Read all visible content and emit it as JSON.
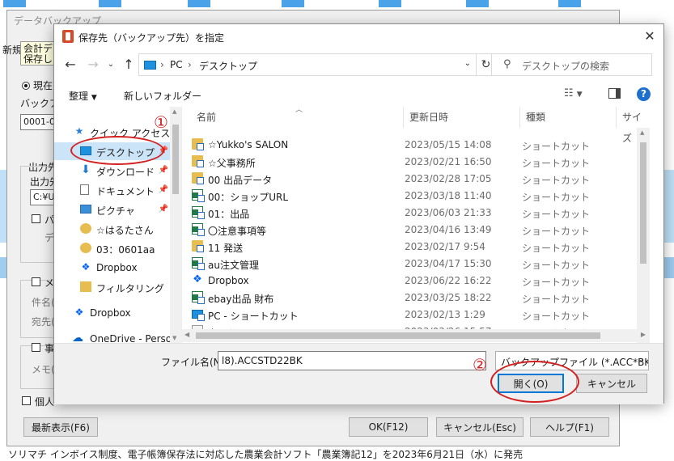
{
  "background": {
    "news_line": "ソリマチ インボイス制度、電子帳簿保存法に対応した農業会計ソフト「農業簿記12」を2023年6月21日（水）に発売"
  },
  "parent_dialog": {
    "title": "データバックアップ",
    "frag_new": "新規",
    "frag_kaikei": "会計デ",
    "frag_hozon": "保存し",
    "radio_current": "現在",
    "label_backup": "バックア",
    "input_code": "0001-0",
    "label_output": "出力先",
    "label_output2": "出力先",
    "input_path": "C:¥U",
    "chk_pa": "パ",
    "frag_de": "デ",
    "chk_me": "メ",
    "frag_kenmei": "件名(",
    "frag_atesaki": "宛先(",
    "chk_ji": "事",
    "frag_memo": "メモ(",
    "chk_kojin": "個人",
    "refresh_button": "最新表示(F6)",
    "ok_button": "OK(F12)",
    "cancel_button": "キャンセル(Esc)",
    "help_button": "ヘルプ(F1)"
  },
  "dialog": {
    "title": "保存先（バックアップ先）を指定",
    "breadcrumb": [
      "PC",
      "デスクトップ"
    ],
    "search_placeholder": "デスクトップの検索",
    "toolbar": {
      "organize": "整理",
      "new_folder": "新しいフォルダー"
    },
    "nav_items": [
      {
        "label": "クイック アクセス",
        "icon": "star-icon"
      },
      {
        "label": "デスクトップ",
        "icon": "desktop-icon",
        "selected": true
      },
      {
        "label": "ダウンロード",
        "icon": "download-icon"
      },
      {
        "label": "ドキュメント",
        "icon": "document-icon"
      },
      {
        "label": "ピクチャ",
        "icon": "pictures-icon"
      },
      {
        "label": "☆はるたさん",
        "icon": "shortcut-folder-icon"
      },
      {
        "label": "03：0601aa",
        "icon": "shortcut-folder-icon"
      },
      {
        "label": "Dropbox",
        "icon": "dropbox-icon"
      },
      {
        "label": "フィルタリング",
        "icon": "folder-icon"
      },
      {
        "label": "Dropbox",
        "icon": "dropbox-icon"
      },
      {
        "label": "OneDrive - Persor",
        "icon": "onedrive-icon"
      }
    ],
    "columns": {
      "name": "名前",
      "date": "更新日時",
      "type": "種類",
      "size": "サイズ"
    },
    "files": [
      {
        "name": "☆Yukko's SALON",
        "date": "2023/05/15 14:08",
        "type": "ショートカット",
        "icon": "folder-shortcut"
      },
      {
        "name": "☆父事務所",
        "date": "2023/02/21 16:50",
        "type": "ショートカット",
        "icon": "folder-shortcut"
      },
      {
        "name": "00 出品データ",
        "date": "2023/02/28 17:05",
        "type": "ショートカット",
        "icon": "folder-shortcut"
      },
      {
        "name": "00：ショップURL",
        "date": "2023/03/18 11:40",
        "type": "ショートカット",
        "icon": "excel-shortcut"
      },
      {
        "name": "01：出品",
        "date": "2023/06/03 21:33",
        "type": "ショートカット",
        "icon": "excel-shortcut"
      },
      {
        "name": "〇注意事項等",
        "date": "2023/04/16 13:49",
        "type": "ショートカット",
        "icon": "excel-shortcut"
      },
      {
        "name": "11 発送",
        "date": "2023/02/17 9:54",
        "type": "ショートカット",
        "icon": "folder-shortcut"
      },
      {
        "name": "au注文管理",
        "date": "2023/04/17 15:30",
        "type": "ショートカット",
        "icon": "excel-shortcut"
      },
      {
        "name": "Dropbox",
        "date": "2023/06/22 16:22",
        "type": "ショートカット",
        "icon": "dropbox"
      },
      {
        "name": "ebay出品 財布",
        "date": "2023/03/25 18:22",
        "type": "ショートカット",
        "icon": "excel-shortcut"
      },
      {
        "name": "PC - ショートカット",
        "date": "2023/02/13 1:29",
        "type": "ショートカット",
        "icon": "pc-shortcut"
      },
      {
        "name": "カード",
        "date": "2023/03/26 15:57",
        "type": "ショートカット",
        "icon": "generic"
      }
    ],
    "filename_label": "ファイル名(N):",
    "filename_value": "l8).ACCSTD22BK",
    "filetype_value": "バックアップファイル (*.ACC*BK;*.ca",
    "open_button": "開く(O)",
    "cancel_button": "キャンセル"
  },
  "annotations": {
    "step1": "①",
    "step2": "②",
    "color": "#d32020"
  }
}
